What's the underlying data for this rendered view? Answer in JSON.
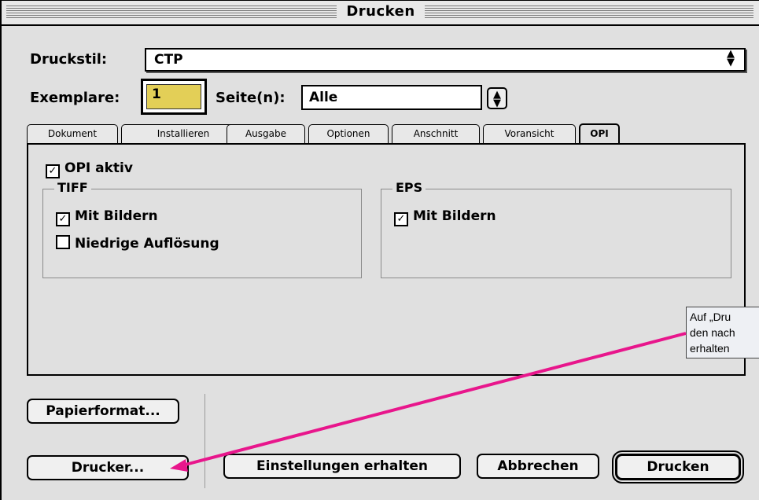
{
  "window": {
    "title": "Drucken"
  },
  "druckstil": {
    "label": "Druckstil:",
    "value": "CTP"
  },
  "exemplare": {
    "label": "Exemplare:",
    "value": "1"
  },
  "seiten": {
    "label": "Seite(n):",
    "value": "Alle"
  },
  "tabs": [
    {
      "label": "Dokument"
    },
    {
      "label": "Installieren"
    },
    {
      "label": "Ausgabe"
    },
    {
      "label": "Optionen"
    },
    {
      "label": "Anschnitt"
    },
    {
      "label": "Voransicht"
    },
    {
      "label": "OPI"
    }
  ],
  "opi": {
    "active_label": "OPI aktiv",
    "active_checked": true,
    "tiff": {
      "title": "TIFF",
      "mit_bildern": "Mit Bildern",
      "mit_bildern_checked": true,
      "niedrige": "Niedrige Auflösung",
      "niedrige_checked": false
    },
    "eps": {
      "title": "EPS",
      "mit_bildern": "Mit Bildern",
      "mit_bildern_checked": true
    }
  },
  "buttons": {
    "papierformat": "Papierformat...",
    "drucker": "Drucker...",
    "einstellungen": "Einstellungen erhalten",
    "abbrechen": "Abbrechen",
    "drucken": "Drucken"
  },
  "callout": {
    "lines": [
      "Auf „Dru",
      "den nach",
      "erhalten"
    ]
  },
  "colors": {
    "exemplare_field": "#e3cf57",
    "annotation_arrow": "#e8168c"
  }
}
